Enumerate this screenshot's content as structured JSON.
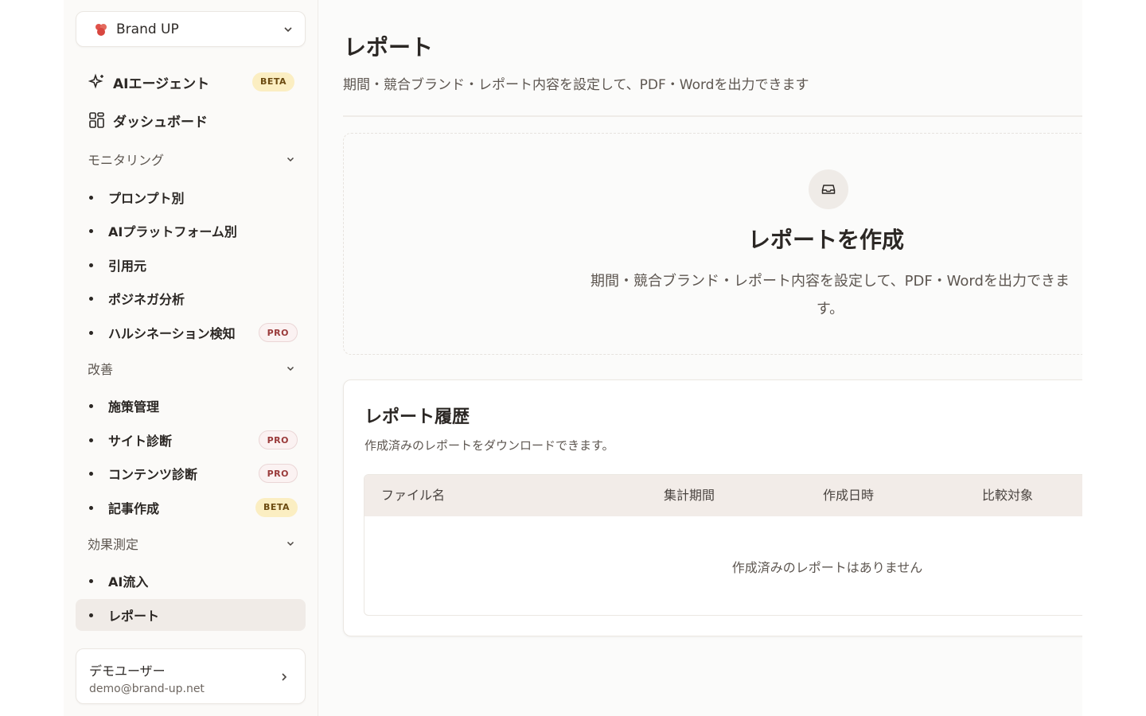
{
  "brand": {
    "name": "Brand UP"
  },
  "nav": {
    "ai_agent": {
      "label": "AIエージェント",
      "badge": "BETA"
    },
    "dashboard": {
      "label": "ダッシュボード"
    }
  },
  "sections": {
    "monitoring": {
      "label": "モニタリング",
      "items": [
        {
          "label": "プロンプト別"
        },
        {
          "label": "AIプラットフォーム別"
        },
        {
          "label": "引用元"
        },
        {
          "label": "ポジネガ分析"
        },
        {
          "label": "ハルシネーション検知",
          "badge": "PRO"
        }
      ]
    },
    "improvement": {
      "label": "改善",
      "items": [
        {
          "label": "施策管理"
        },
        {
          "label": "サイト診断",
          "badge": "PRO"
        },
        {
          "label": "コンテンツ診断",
          "badge": "PRO"
        },
        {
          "label": "記事作成",
          "badge": "BETA"
        }
      ]
    },
    "measurement": {
      "label": "効果測定",
      "items": [
        {
          "label": "AI流入"
        },
        {
          "label": "レポート",
          "active": true
        }
      ]
    }
  },
  "user": {
    "name": "デモユーザー",
    "email": "demo@brand-up.net"
  },
  "page": {
    "title": "レポート",
    "subtitle": "期間・競合ブランド・レポート内容を設定して、PDF・Wordを出力できます"
  },
  "create": {
    "title": "レポートを作成",
    "description": "期間・競合ブランド・レポート内容を設定して、PDF・Wordを出力できます。"
  },
  "history": {
    "title": "レポート履歴",
    "description": "作成済みのレポートをダウンロードできます。",
    "columns": [
      "ファイル名",
      "集計期間",
      "作成日時",
      "比較対象"
    ],
    "empty": "作成済みのレポートはありません"
  },
  "colors": {
    "accent_beta": "#fbeec2",
    "accent_pro": "#9a3a3a",
    "active_bg": "#f0ebe7"
  }
}
